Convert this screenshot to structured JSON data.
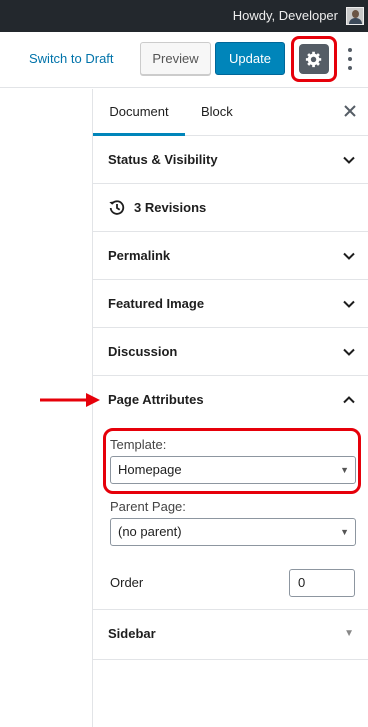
{
  "admin_bar": {
    "greeting": "Howdy, Developer",
    "avatar_icon": "user-avatar"
  },
  "header": {
    "switch_to_draft": "Switch to Draft",
    "preview": "Preview",
    "update": "Update",
    "settings_icon": "gear-icon",
    "more_icon": "vertical-ellipsis-icon"
  },
  "sidebar": {
    "tabs": [
      {
        "label": "Document",
        "active": true
      },
      {
        "label": "Block",
        "active": false
      }
    ],
    "close_icon": "close-icon",
    "panels": {
      "status_visibility": "Status & Visibility",
      "revisions": "3 Revisions",
      "permalink": "Permalink",
      "featured_image": "Featured Image",
      "discussion": "Discussion",
      "page_attributes": "Page Attributes",
      "sidebar": "Sidebar"
    },
    "page_attributes": {
      "template_label": "Template:",
      "template_value": "Homepage",
      "parent_label": "Parent Page:",
      "parent_value": "(no parent)",
      "order_label": "Order",
      "order_value": "0"
    }
  },
  "colors": {
    "admin_bar": "#23282d",
    "link": "#0073aa",
    "primary_button": "#0085ba",
    "highlight": "#e6000a",
    "settings_button": "#555d66"
  }
}
